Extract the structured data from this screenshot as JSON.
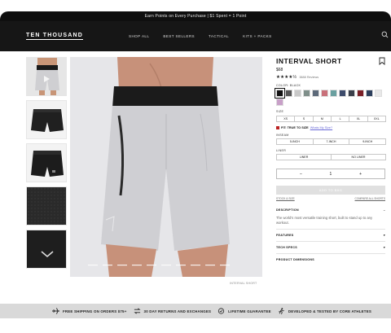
{
  "promo_bar": {
    "text": "Earn Points on Every Purchase | $1 Spent = 1 Point"
  },
  "header": {
    "logo": "TEN THOUSAND",
    "menu": [
      "SHOP ALL",
      "BEST SELLERS",
      "TACTICAL",
      "KITS + PACKS"
    ],
    "search_icon": "search-icon"
  },
  "gallery": {
    "thumbnails": [
      "front-gray-model",
      "black-short-front",
      "black-short-back",
      "black-fabric-closeup",
      "black-waistband-detail"
    ],
    "main_image": "interval-short-gray-front",
    "credit": "INTERVAL SHORT"
  },
  "product": {
    "title": "INTERVAL SHORT",
    "price": "$68",
    "stars": "★★★★½",
    "reviews": "3888 Reviews",
    "color_label": "COLOR: BLACK",
    "colors": [
      "#111111",
      "#555555",
      "#c9c9c9",
      "#7f8f8a",
      "#5d6a7a",
      "#c9707a",
      "#6aa0a0",
      "#3d4b6b",
      "#3a3f4a",
      "#7a1f26",
      "#2c3f5c",
      "#e8e8e8",
      "#c8a0c8"
    ],
    "size_label": "SIZE",
    "sizes": [
      "XS",
      "S",
      "M",
      "L",
      "XL",
      "XXL"
    ],
    "fit_text": "FIT: TRUE TO SIZE",
    "fit_link": "Whats My Size?",
    "inseam_label": "INSEAM",
    "inseams": [
      "5-INCH",
      "7-INCH",
      "9-INCH"
    ],
    "liner_label": "LINER",
    "liners": [
      "LINER",
      "NO LINER"
    ],
    "qty_minus": "–",
    "qty_value": "1",
    "qty_plus": "+",
    "add_to_cart": "ADD TO BAG",
    "stock_link": "STOCK & SIZE",
    "compare_link": "COMPARE ALL SHORTS",
    "description_label": "DESCRIPTION",
    "description_text": "The world's most versatile training short, built to stand up to any workout.",
    "accordion": [
      "FEATURES",
      "TECH SPECS",
      "PRODUCT DIMENSIONS"
    ]
  },
  "footer": {
    "items": [
      {
        "icon": "plane-icon",
        "text": "FREE SHIPPING ON ORDERS $75+"
      },
      {
        "icon": "returns-icon",
        "text": "30 DAY RETURNS AND EXCHANGES"
      },
      {
        "icon": "check-circle-icon",
        "text": "LIFETIME GUARANTEE"
      },
      {
        "icon": "runner-icon",
        "text": "DEVELOPED & TESTED BY CORE ATHLETES"
      }
    ]
  }
}
